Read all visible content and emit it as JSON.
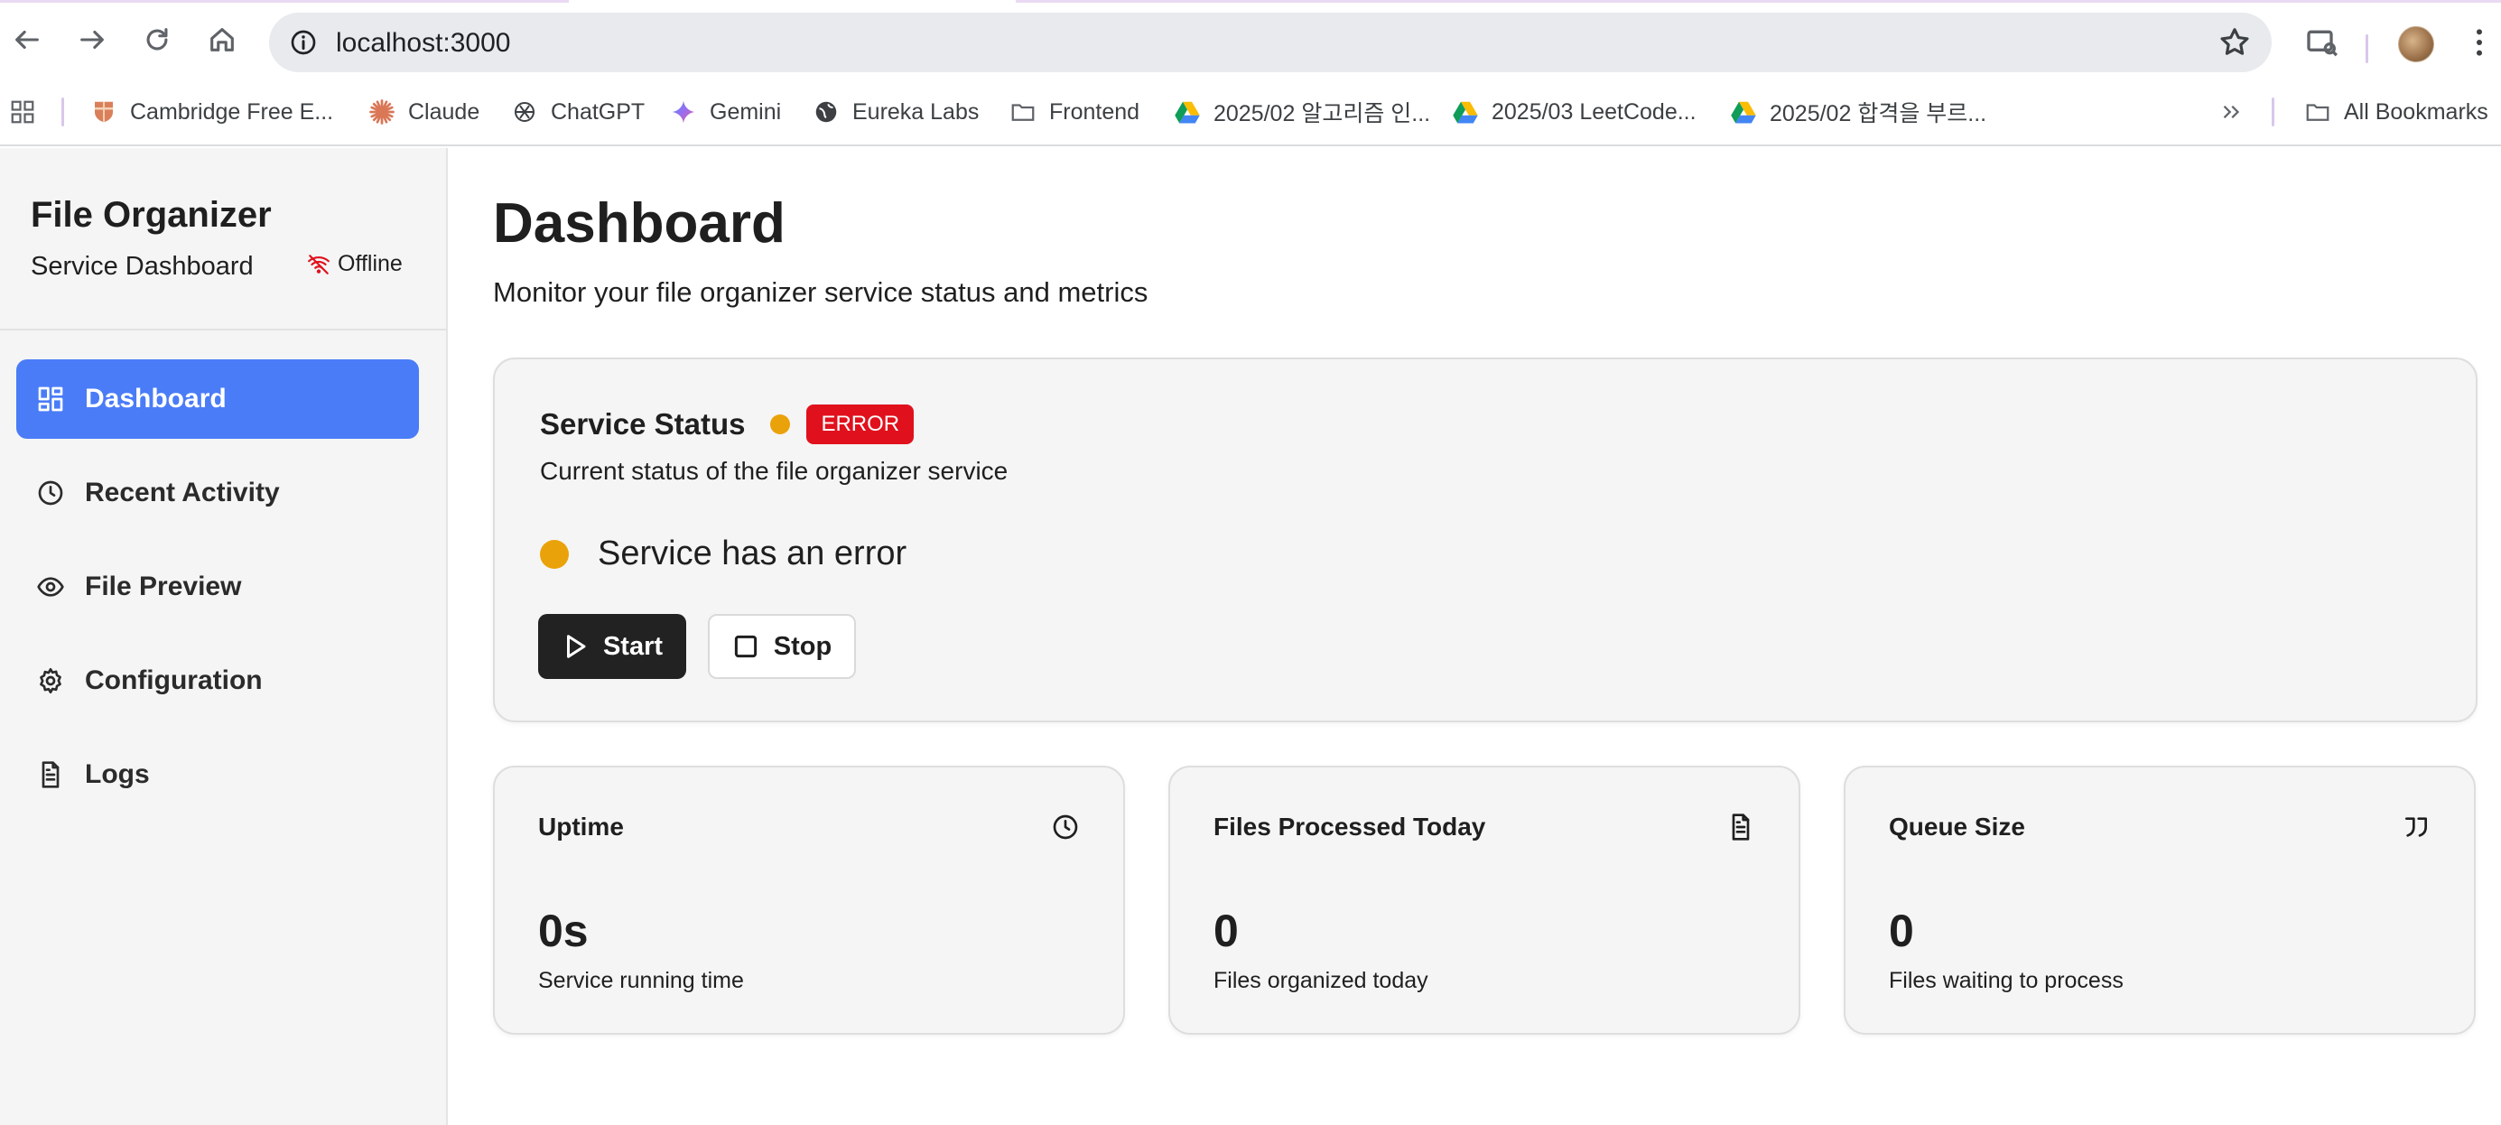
{
  "browser": {
    "url": "localhost:3000",
    "bookmarks": [
      {
        "label": "Cambridge Free E...",
        "icon": "cambridge-shield-icon"
      },
      {
        "label": "Claude",
        "icon": "claude-icon"
      },
      {
        "label": "ChatGPT",
        "icon": "chatgpt-icon"
      },
      {
        "label": "Gemini",
        "icon": "gemini-icon"
      },
      {
        "label": "Eureka Labs",
        "icon": "globe-icon"
      },
      {
        "label": "Frontend",
        "icon": "folder-icon"
      },
      {
        "label": "2025/02 알고리즘 인...",
        "icon": "google-drive-icon"
      },
      {
        "label": "2025/03 LeetCode...",
        "icon": "google-drive-icon"
      },
      {
        "label": "2025/02 합격을 부르...",
        "icon": "google-drive-icon"
      }
    ],
    "all_bookmarks": "All Bookmarks"
  },
  "sidebar": {
    "title": "File Organizer",
    "subtitle": "Service Dashboard",
    "connection": "Offline",
    "items": [
      {
        "label": "Dashboard",
        "icon": "grid-icon",
        "active": true
      },
      {
        "label": "Recent Activity",
        "icon": "clock-icon",
        "active": false
      },
      {
        "label": "File Preview",
        "icon": "eye-icon",
        "active": false
      },
      {
        "label": "Configuration",
        "icon": "gear-icon",
        "active": false
      },
      {
        "label": "Logs",
        "icon": "file-text-icon",
        "active": false
      }
    ]
  },
  "main": {
    "title": "Dashboard",
    "subtitle": "Monitor your file organizer service status and metrics",
    "status": {
      "title": "Service Status",
      "badge": "ERROR",
      "description": "Current status of the file organizer service",
      "message": "Service has an error",
      "start_label": "Start",
      "stop_label": "Stop"
    },
    "metrics": [
      {
        "title": "Uptime",
        "value": "0s",
        "description": "Service running time",
        "icon": "clock-icon"
      },
      {
        "title": "Files Processed Today",
        "value": "0",
        "description": "Files organized today",
        "icon": "file-text-icon"
      },
      {
        "title": "Queue Size",
        "value": "0",
        "description": "Files waiting to process",
        "icon": "quote-icon"
      }
    ]
  },
  "colors": {
    "accent": "#4a7cf7",
    "status_dot": "#eaa20a",
    "error_badge": "#e0111d",
    "offline_icon": "#e0111d"
  }
}
